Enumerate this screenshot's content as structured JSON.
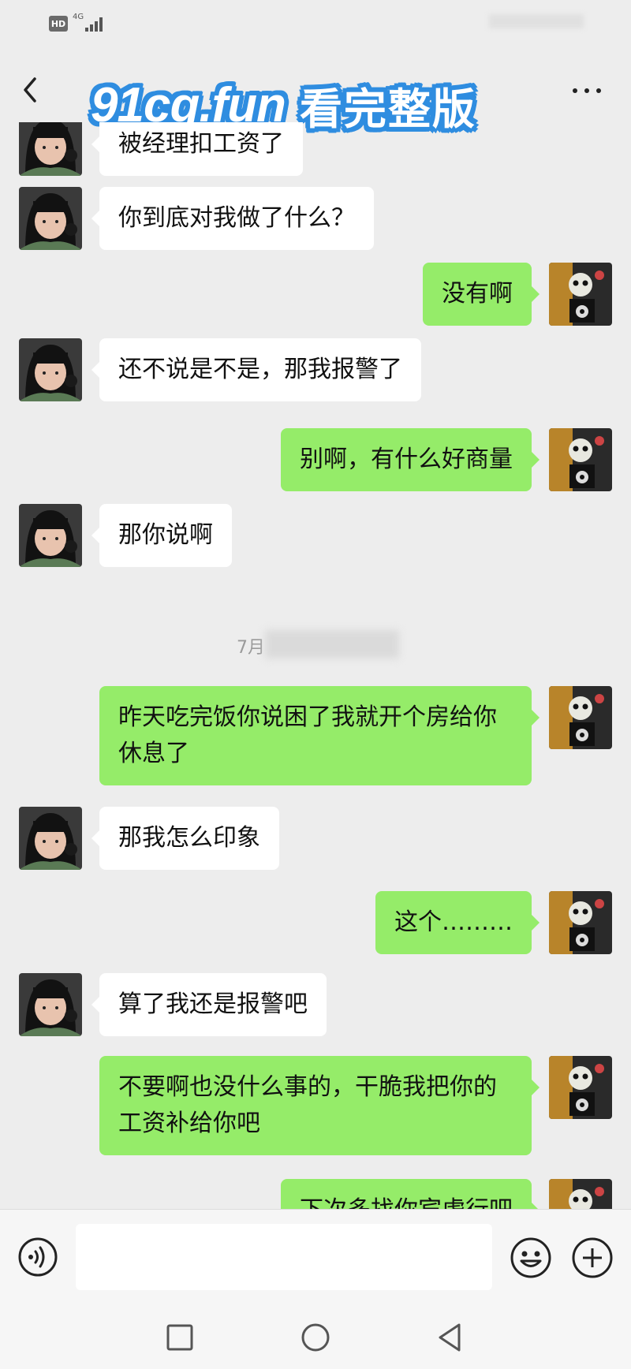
{
  "status_bar": {
    "hd": "HD",
    "network": "4G"
  },
  "header": {
    "watermark_latin": "91cg.fun",
    "watermark_cjk": "看完整版"
  },
  "messages": [
    {
      "side": "left",
      "text": "被经理扣工资了"
    },
    {
      "side": "left",
      "text": "你到底对我做了什么？"
    },
    {
      "side": "right",
      "text": "没有啊"
    },
    {
      "side": "left",
      "text": "还不说是不是，那我报警了"
    },
    {
      "side": "right",
      "text": "别啊，有什么好商量"
    },
    {
      "side": "left",
      "text": "那你说啊"
    },
    {
      "side": "right",
      "text": "昨天吃完饭你说困了我就开个房给你休息了"
    },
    {
      "side": "left",
      "text": "那我怎么印象"
    },
    {
      "side": "right",
      "text": "这个………"
    },
    {
      "side": "left",
      "text": "算了我还是报警吧"
    },
    {
      "side": "right",
      "text": "不要啊也没什么事的，干脆我把你的工资补给你吧"
    },
    {
      "side": "right",
      "text": "下次多找你宾虚行吧"
    }
  ],
  "timestamp": "7月",
  "input": {
    "placeholder": ""
  },
  "colors": {
    "background": "#ededed",
    "bubble_self": "#95ec69",
    "bubble_other": "#ffffff",
    "watermark_outline": "#2f8de0"
  },
  "icons": [
    "back-icon",
    "more-icon",
    "voice-icon",
    "emoji-icon",
    "plus-icon",
    "recents-icon",
    "home-icon",
    "back-nav-icon"
  ]
}
